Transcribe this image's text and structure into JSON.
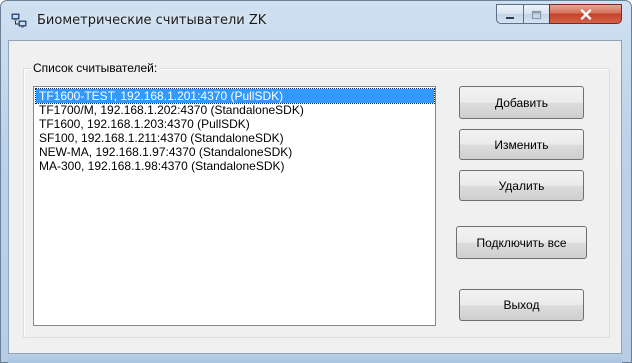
{
  "window": {
    "title": "Биометрические считыватели ZK",
    "icon": "network-computers-icon",
    "caption_buttons": [
      "minimize-icon",
      "maximize-icon",
      "close-icon"
    ],
    "close_color": "#c5432a"
  },
  "group": {
    "label": "Список считывателей:"
  },
  "readers": {
    "items": [
      "TF1600-TEST, 192.168.1.201:4370 (PullSDK)",
      "TF1700/M, 192.168.1.202:4370 (StandaloneSDK)",
      "TF1600, 192.168.1.203:4370 (PullSDK)",
      "SF100, 192.168.1.211:4370 (StandaloneSDK)",
      "NEW-MA, 192.168.1.97:4370 (StandaloneSDK)",
      "MA-300, 192.168.1.98:4370 (StandaloneSDK)"
    ],
    "selected_index": 0,
    "selection_color": "#3399ff"
  },
  "buttons": {
    "add": "Добавить",
    "edit": "Изменить",
    "delete": "Удалить",
    "connect_all": "Подключить все",
    "exit": "Выход"
  }
}
